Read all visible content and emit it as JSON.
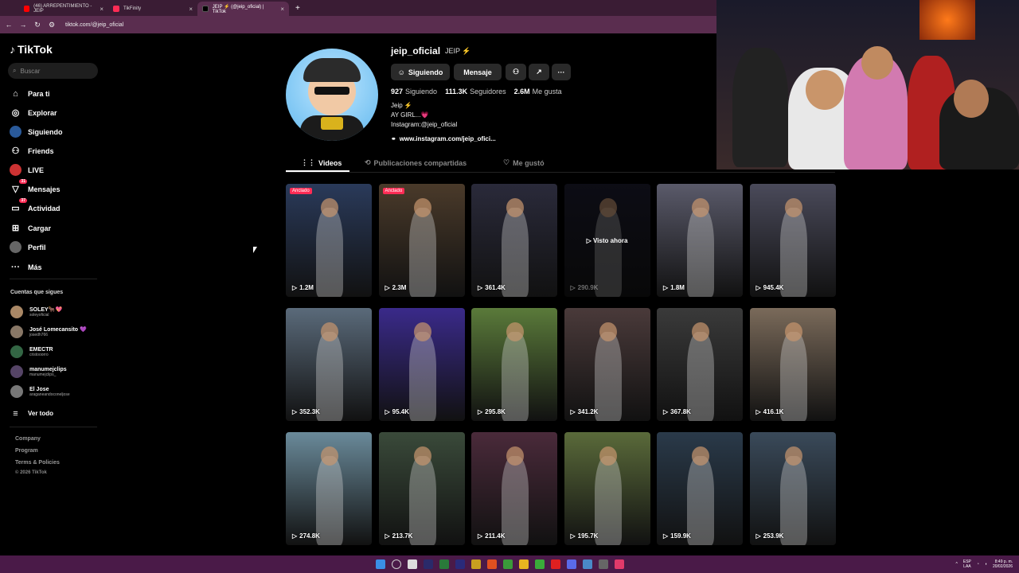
{
  "browser": {
    "tabs": [
      {
        "label": "(46) ARREPENTIMIENTO - JEIP",
        "color": "#ff0000"
      },
      {
        "label": "TikFinity",
        "color": "#fe2c55"
      },
      {
        "label": "JEIP ⚡ (@jeip_oficial) | TikTok",
        "color": "#000000"
      }
    ],
    "url": "tiktok.com/@jeip_oficial"
  },
  "sidebar": {
    "logo": "TikTok",
    "search_placeholder": "Buscar",
    "items": [
      {
        "label": "Para ti",
        "icon": "home-icon"
      },
      {
        "label": "Explorar",
        "icon": "compass-icon"
      },
      {
        "label": "Siguiendo",
        "icon": "following-icon"
      },
      {
        "label": "Friends",
        "icon": "friends-icon"
      },
      {
        "label": "LIVE",
        "icon": "live-icon"
      },
      {
        "label": "Mensajes",
        "icon": "messages-icon",
        "badge": "31"
      },
      {
        "label": "Actividad",
        "icon": "activity-icon",
        "badge": "37"
      },
      {
        "label": "Cargar",
        "icon": "upload-icon"
      },
      {
        "label": "Perfil",
        "icon": "profile-icon"
      },
      {
        "label": "Más",
        "icon": "more-icon"
      }
    ],
    "following_title": "Cuentas que sigues",
    "accounts": [
      {
        "name": "SOLEY🐂💖",
        "handle": "soleyoficial"
      },
      {
        "name": "José Lomecansito 💜",
        "handle": "josedh766"
      },
      {
        "name": "EMECTR",
        "handle": "cristooorro"
      },
      {
        "name": "manumejclips",
        "handle": "manumejclips_"
      },
      {
        "name": "El Jose",
        "handle": "araganeandoconeljose"
      }
    ],
    "see_all": "Ver todo",
    "footer": [
      "Company",
      "Program",
      "Terms & Policies",
      "© 2026 TikTok"
    ]
  },
  "profile": {
    "username": "jeip_oficial",
    "nickname": "JEIP ⚡",
    "following_btn": "Siguiendo",
    "message_btn": "Mensaje",
    "stats": [
      {
        "value": "927",
        "label": "Siguiendo"
      },
      {
        "value": "111.3K",
        "label": "Seguidores"
      },
      {
        "value": "2.6M",
        "label": "Me gusta"
      }
    ],
    "bio": [
      "Jeip ⚡",
      "AY GIRL...💗",
      "Instagram:@jeip_oficial"
    ],
    "link": "www.instagram.com/jeip_ofici..."
  },
  "profile_tabs": [
    "Videos",
    "Publicaciones compartidas",
    "Me gustó"
  ],
  "videos": [
    {
      "views": "1.2M",
      "pinned": "Anclado",
      "bg": "#2a3a5a"
    },
    {
      "views": "2.3M",
      "pinned": "Anclado",
      "bg": "#4a3a2a"
    },
    {
      "views": "361.4K",
      "bg": "#2a2a3a"
    },
    {
      "views": "290.9K",
      "watch": "Visto ahora",
      "bg": "#1a1a2a"
    },
    {
      "views": "1.8M",
      "bg": "#5a5a6a"
    },
    {
      "views": "945.4K",
      "bg": "#4a4a5a"
    },
    {
      "views": "352.3K",
      "bg": "#5a6a7a"
    },
    {
      "views": "95.4K",
      "bg": "#3a2a8a"
    },
    {
      "views": "295.8K",
      "bg": "#5a7a3a"
    },
    {
      "views": "341.2K",
      "bg": "#4a3a3a"
    },
    {
      "views": "367.8K",
      "bg": "#3a3a3a"
    },
    {
      "views": "416.1K",
      "bg": "#7a6a5a"
    },
    {
      "views": "274.8K",
      "bg": "#6a8a9a"
    },
    {
      "views": "213.7K",
      "bg": "#3a4a3a"
    },
    {
      "views": "211.4K",
      "bg": "#4a2a3a"
    },
    {
      "views": "195.7K",
      "bg": "#5a6a3a"
    },
    {
      "views": "159.9K",
      "bg": "#2a3a4a"
    },
    {
      "views": "253.9K",
      "bg": "#3a4a5a"
    }
  ],
  "taskbar": {
    "lang": "ESP\nLAA",
    "time": "8:49 p. m.",
    "date": "20/02/2026"
  }
}
